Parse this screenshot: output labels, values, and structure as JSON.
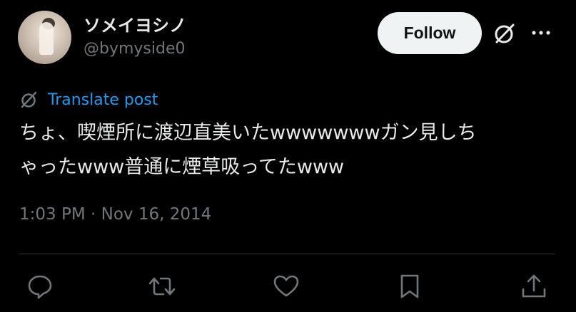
{
  "author": {
    "display_name": "ソメイヨシノ",
    "handle": "@bymyside0"
  },
  "follow_button": {
    "label": "Follow"
  },
  "icons": {
    "grok": "grok-icon",
    "more": "more-options-icon",
    "translate": "translate-icon",
    "reply": "reply-icon",
    "repost": "repost-icon",
    "like": "like-icon",
    "bookmark": "bookmark-icon",
    "share": "share-icon"
  },
  "translate": {
    "label": "Translate post"
  },
  "post": {
    "line1": "ちょ、喫煙所に渡辺直美いたwwwwwwwガン見しち",
    "line2": "ゃったwww普通に煙草吸ってたwww"
  },
  "meta": {
    "time": "1:03 PM",
    "separator": "·",
    "date": "Nov 16, 2014"
  },
  "colors": {
    "background": "#000000",
    "text": "#e7e9ea",
    "secondary": "#71767b",
    "link": "#1d9bf0",
    "follow_bg": "#eff3f4",
    "divider": "#2f3336"
  }
}
